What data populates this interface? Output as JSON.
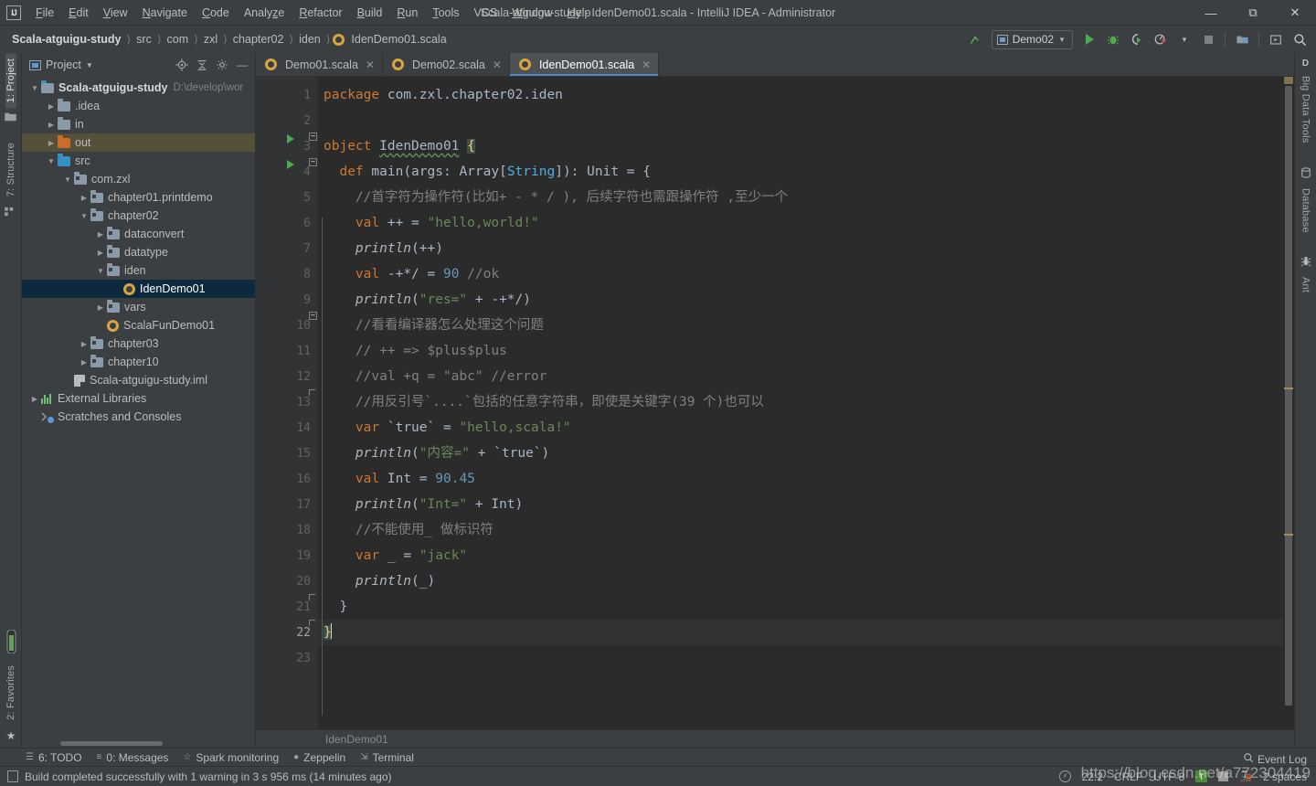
{
  "window": {
    "title": "Scala-atguigu-study - IdenDemo01.scala - IntelliJ IDEA - Administrator",
    "logo": "IJ",
    "minimize": "—",
    "maximize": "❐",
    "close": "✕"
  },
  "menu": [
    {
      "label": "File"
    },
    {
      "label": "Edit"
    },
    {
      "label": "View"
    },
    {
      "label": "Navigate"
    },
    {
      "label": "Code"
    },
    {
      "label": "Analyze"
    },
    {
      "label": "Refactor"
    },
    {
      "label": "Build"
    },
    {
      "label": "Run"
    },
    {
      "label": "Tools"
    },
    {
      "label": "VCS"
    },
    {
      "label": "Window"
    },
    {
      "label": "Help"
    }
  ],
  "breadcrumbs": [
    {
      "label": "Scala-atguigu-study",
      "bold": true
    },
    {
      "label": "src"
    },
    {
      "label": "com"
    },
    {
      "label": "zxl"
    },
    {
      "label": "chapter02"
    },
    {
      "label": "iden"
    },
    {
      "label": "IdenDemo01.scala",
      "icon": "scala-file-icon"
    }
  ],
  "toolbar": {
    "run_config": "Demo02",
    "icons": [
      "update-project-icon",
      "run-icon",
      "debug-icon",
      "run-coverage-icon",
      "profile-icon",
      "stop-icon",
      "project-structure-icon",
      "hide-window-icon",
      "search-everywhere-icon"
    ]
  },
  "left_rail": {
    "top": [
      {
        "label": "1: Project",
        "active": true,
        "icon": "project-icon"
      },
      {
        "label": "7: Structure",
        "active": false,
        "icon": "structure-icon"
      }
    ],
    "bottom": [
      {
        "label": "2: Favorites",
        "icon": "favorites-icon"
      }
    ],
    "star": "★"
  },
  "right_rail": [
    {
      "label": "Big Data Tools",
      "icon": "big-data-tools-icon"
    },
    {
      "label": "Database",
      "icon": "database-icon"
    },
    {
      "label": "Ant",
      "icon": "ant-icon"
    }
  ],
  "project_panel": {
    "title": "Project",
    "header_icons": [
      "locate-icon",
      "collapse-all-icon",
      "gear-icon",
      "hide-icon"
    ],
    "tree": [
      {
        "label": "Scala-atguigu-study",
        "path": "D:\\develop\\wor",
        "indent": 0,
        "arrow": "▼",
        "icon": "module-folder",
        "bold": true,
        "state": "normal"
      },
      {
        "label": ".idea",
        "indent": 1,
        "arrow": "▶",
        "icon": "folder-gray",
        "state": "normal"
      },
      {
        "label": "in",
        "indent": 1,
        "arrow": "▶",
        "icon": "folder-gray",
        "state": "normal"
      },
      {
        "label": "out",
        "indent": 1,
        "arrow": "▶",
        "icon": "folder-orange",
        "state": "sel-out"
      },
      {
        "label": "src",
        "indent": 1,
        "arrow": "▼",
        "icon": "folder-blue",
        "state": "normal"
      },
      {
        "label": "com.zxl",
        "indent": 2,
        "arrow": "▼",
        "icon": "package",
        "state": "normal"
      },
      {
        "label": "chapter01.printdemo",
        "indent": 3,
        "arrow": "▶",
        "icon": "package",
        "state": "normal"
      },
      {
        "label": "chapter02",
        "indent": 3,
        "arrow": "▼",
        "icon": "package",
        "state": "normal"
      },
      {
        "label": "dataconvert",
        "indent": 4,
        "arrow": "▶",
        "icon": "package",
        "state": "normal"
      },
      {
        "label": "datatype",
        "indent": 4,
        "arrow": "▶",
        "icon": "package",
        "state": "normal"
      },
      {
        "label": "iden",
        "indent": 4,
        "arrow": "▼",
        "icon": "package",
        "state": "normal"
      },
      {
        "label": "IdenDemo01",
        "indent": 5,
        "arrow": "none",
        "icon": "scala-file",
        "state": "sel-file"
      },
      {
        "label": "vars",
        "indent": 4,
        "arrow": "▶",
        "icon": "package",
        "state": "normal"
      },
      {
        "label": "ScalaFunDemo01",
        "indent": 4,
        "arrow": "none",
        "icon": "scala-file",
        "state": "normal"
      },
      {
        "label": "chapter03",
        "indent": 3,
        "arrow": "▶",
        "icon": "package",
        "state": "normal"
      },
      {
        "label": "chapter10",
        "indent": 3,
        "arrow": "▶",
        "icon": "package",
        "state": "normal"
      },
      {
        "label": "Scala-atguigu-study.iml",
        "indent": 2,
        "arrow": "none",
        "icon": "iml-file",
        "state": "normal"
      },
      {
        "label": "External Libraries",
        "indent": 0,
        "arrow": "▶",
        "icon": "libraries",
        "state": "normal"
      },
      {
        "label": "Scratches and Consoles",
        "indent": 0,
        "arrow": "none",
        "icon": "scratches",
        "state": "normal"
      }
    ]
  },
  "editor": {
    "tabs": [
      {
        "label": "Demo01.scala",
        "active": false,
        "icon": "scala-file-icon",
        "close": "✕"
      },
      {
        "label": "Demo02.scala",
        "active": false,
        "icon": "scala-file-icon",
        "close": "✕"
      },
      {
        "label": "IdenDemo01.scala",
        "active": true,
        "icon": "scala-file-icon",
        "close": "✕"
      }
    ],
    "breadcrumb_bottom": "IdenDemo01",
    "line_numbers": [
      1,
      2,
      3,
      4,
      5,
      6,
      7,
      8,
      9,
      10,
      11,
      12,
      13,
      14,
      15,
      16,
      17,
      18,
      19,
      20,
      21,
      22,
      23
    ],
    "current_line": 22,
    "run_marker_lines": [
      3,
      4
    ],
    "code_lines": [
      {
        "n": 1,
        "text": "package com.zxl.chapter02.iden"
      },
      {
        "n": 2,
        "text": ""
      },
      {
        "n": 3,
        "text": "object IdenDemo01 {"
      },
      {
        "n": 4,
        "text": "  def main(args: Array[String]): Unit = {"
      },
      {
        "n": 5,
        "text": "    //首字符为操作符(比如+ - * / ), 后续字符也需跟操作符 ,至少一个"
      },
      {
        "n": 6,
        "text": "    val ++ = \"hello,world!\""
      },
      {
        "n": 7,
        "text": "    println(++)"
      },
      {
        "n": 8,
        "text": "    val -+*/ = 90 //ok"
      },
      {
        "n": 9,
        "text": "    println(\"res=\" + -+*/)"
      },
      {
        "n": 10,
        "text": "    //看看编译器怎么处理这个问题"
      },
      {
        "n": 11,
        "text": "    // ++ => $plus$plus"
      },
      {
        "n": 12,
        "text": "    //val +q = \"abc\" //error"
      },
      {
        "n": 13,
        "text": "    //用反引号`....`包括的任意字符串，即使是关键字(39 个)也可以"
      },
      {
        "n": 14,
        "text": "    var `true` = \"hello,scala!\""
      },
      {
        "n": 15,
        "text": "    println(\"内容=\" + `true`)"
      },
      {
        "n": 16,
        "text": "    val Int = 90.45"
      },
      {
        "n": 17,
        "text": "    println(\"Int=\" + Int)"
      },
      {
        "n": 18,
        "text": "    //不能使用_ 做标识符"
      },
      {
        "n": 19,
        "text": "    var _ = \"jack\""
      },
      {
        "n": 20,
        "text": "    println(_)"
      },
      {
        "n": 21,
        "text": "  }"
      },
      {
        "n": 22,
        "text": "}"
      },
      {
        "n": 23,
        "text": ""
      }
    ]
  },
  "bottom_windows": [
    {
      "label": "6: TODO",
      "mnemonic": "6",
      "rest": ": TODO",
      "icon": "todo-icon"
    },
    {
      "label": "0: Messages",
      "mnemonic": "0",
      "rest": ": Messages",
      "icon": "messages-icon"
    },
    {
      "label": "Spark monitoring",
      "icon": "spark-icon"
    },
    {
      "label": "Zeppelin",
      "icon": "zeppelin-icon"
    },
    {
      "label": "Terminal",
      "icon": "terminal-icon"
    }
  ],
  "status_bar": {
    "message": "Build completed successfully with 1 warning in 3 s 956 ms (14 minutes ago)",
    "caret_position": "22:2",
    "line_separator": "CRLF",
    "encoding": "UTF-8",
    "indent": "2 spaces",
    "lock_icon": "T",
    "event_log": "Event Log",
    "watermark": "https://blog.csdn.net/a772304419"
  },
  "colors": {
    "background": "#3c3f41",
    "editor_bg": "#2b2b2b",
    "keyword": "#cc7832",
    "string": "#6a8759",
    "number": "#6897bb",
    "comment": "#808080",
    "class": "#4eade5",
    "accent": "#4a88c7",
    "selection": "#0d293e"
  }
}
